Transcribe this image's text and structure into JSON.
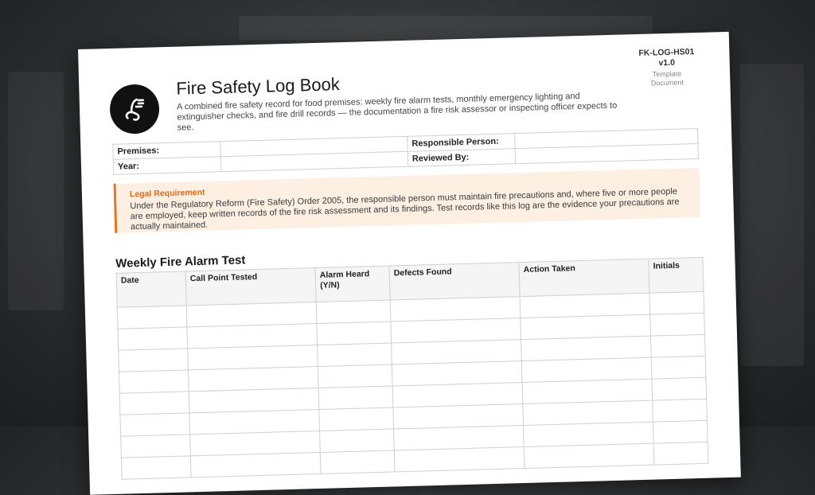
{
  "header": {
    "title": "Fire Safety Log Book",
    "subtitle": "A combined fire safety record for food premises: weekly fire alarm tests, monthly emergency lighting and extinguisher checks, and fire drill records — the documentation a fire risk assessor or inspecting officer expects to see.",
    "doc_code": "FK-LOG-HS01 v1.0",
    "doc_type": "Template Document"
  },
  "logo": {
    "icon": "plug-icon"
  },
  "info": {
    "premises_label": "Premises:",
    "responsible_label": "Responsible Person:",
    "year_label": "Year:",
    "reviewed_label": "Reviewed By:"
  },
  "callout": {
    "title": "Legal Requirement",
    "text": "Under the Regulatory Reform (Fire Safety) Order 2005, the responsible person must maintain fire precautions and, where five or more people are employed, keep written records of the fire risk assessment and its findings. Test records like this log are the evidence your precautions are actually maintained."
  },
  "alarm_section": {
    "title": "Weekly Fire Alarm Test",
    "columns": [
      "Date",
      "Call Point Tested",
      "Alarm Heard (Y/N)",
      "Defects Found",
      "Action Taken",
      "Initials"
    ],
    "row_count": 8
  },
  "colors": {
    "accent": "#e8742a",
    "callout_bg": "#fdf0e2"
  }
}
